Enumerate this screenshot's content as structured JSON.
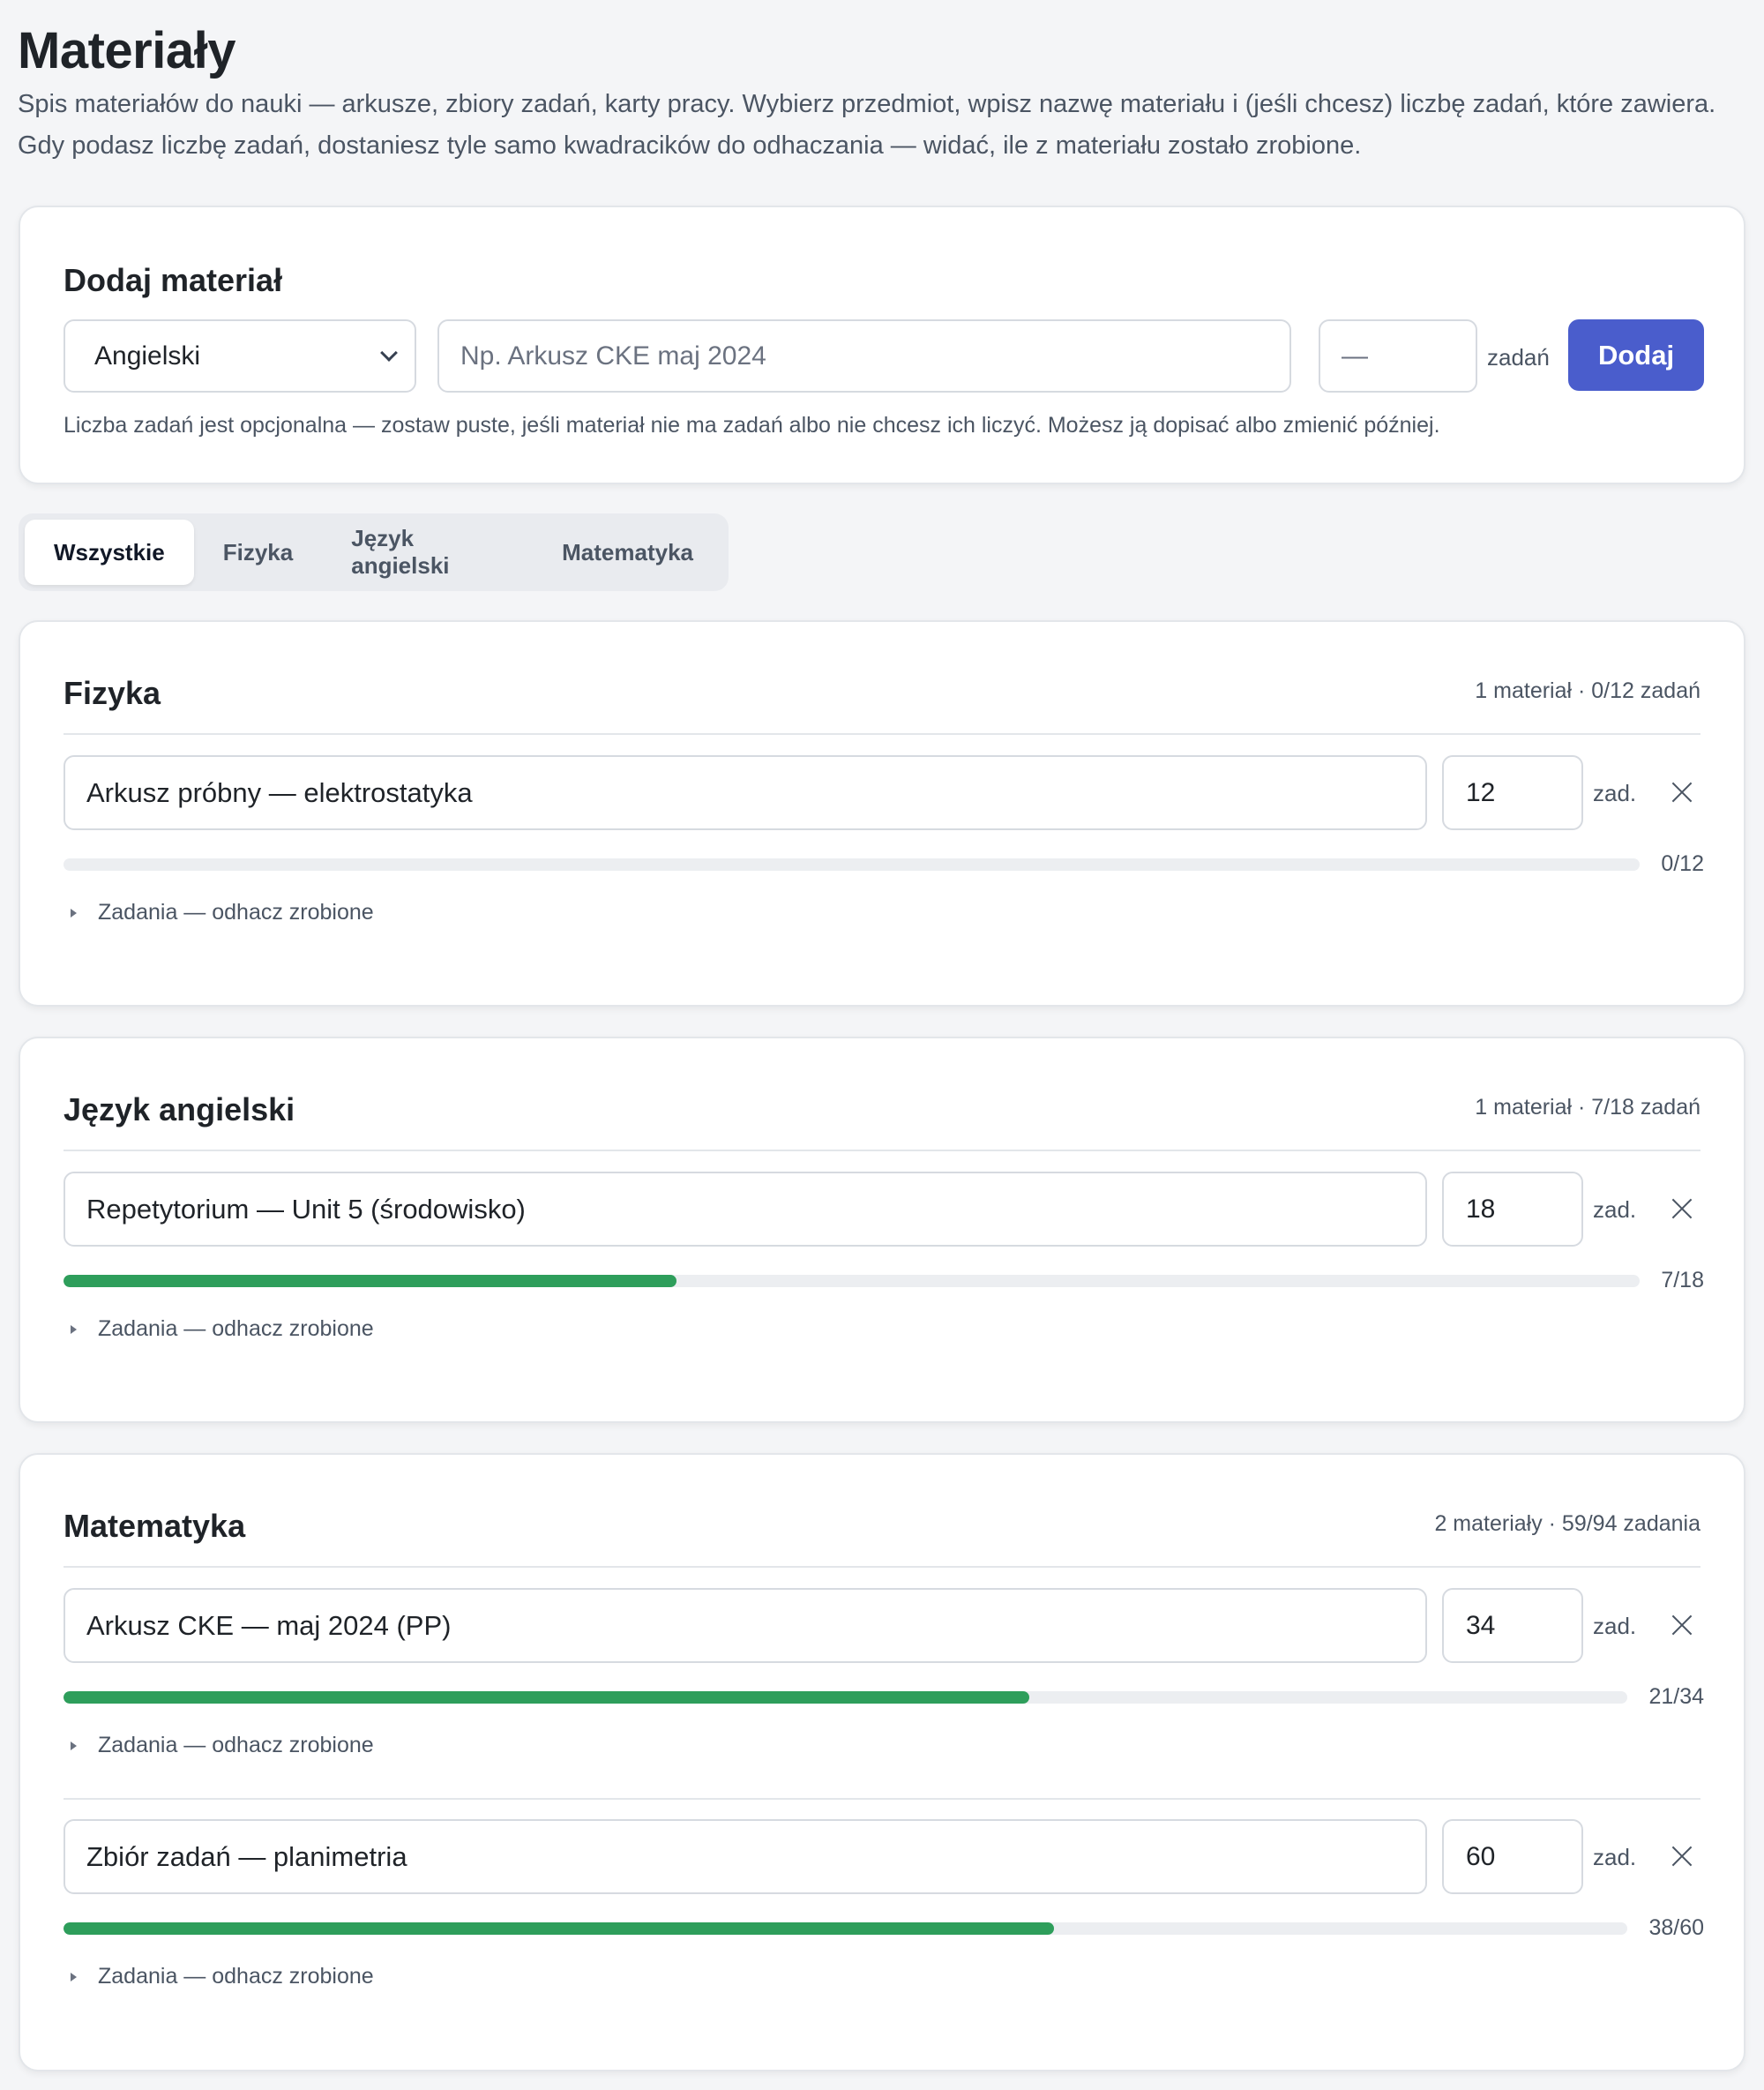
{
  "page": {
    "title": "Materiały",
    "intro_line1": "Spis materiałów do nauki — arkusze, zbiory zadań, karty pracy. Wybierz przedmiot, wpisz nazwę materiału i (jeśli chcesz) liczbę zadań, które zawiera.",
    "intro_line2": "Gdy podasz liczbę zadań, dostaniesz tyle samo kwadracików do odhaczania — widać, ile z materiału zostało zrobione."
  },
  "add_form": {
    "title": "Dodaj materiał",
    "subject_selected": "Angielski",
    "name_placeholder": "Np. Arkusz CKE maj 2024",
    "count_placeholder": "—",
    "count_unit": "zadań",
    "submit_label": "Dodaj",
    "hint": "Liczba zadań jest opcjonalna — zostaw puste, jeśli materiał nie ma zadań albo nie chcesz ich liczyć. Możesz ją dopisać albo zmienić później."
  },
  "tabs": [
    {
      "label": "Wszystkie",
      "active": true
    },
    {
      "label": "Fizyka",
      "active": false
    },
    {
      "label": "Język angielski",
      "active": false
    },
    {
      "label": "Matematyka",
      "active": false
    }
  ],
  "subjects": [
    {
      "title": "Fizyka",
      "summary": "1 materiał · 0/12 zadań",
      "materials": [
        {
          "name": "Arkusz próbny — elektrostatyka",
          "count": "12",
          "unit": "zad.",
          "done": 0,
          "total": 12,
          "progress_label": "0/12",
          "tasks_label": "Zadania — odhacz zrobione"
        }
      ]
    },
    {
      "title": "Język angielski",
      "summary": "1 materiał · 7/18 zadań",
      "materials": [
        {
          "name": "Repetytorium — Unit 5 (środowisko)",
          "count": "18",
          "unit": "zad.",
          "done": 7,
          "total": 18,
          "progress_label": "7/18",
          "tasks_label": "Zadania — odhacz zrobione"
        }
      ]
    },
    {
      "title": "Matematyka",
      "summary": "2 materiały · 59/94 zadania",
      "materials": [
        {
          "name": "Arkusz CKE — maj 2024 (PP)",
          "count": "34",
          "unit": "zad.",
          "done": 21,
          "total": 34,
          "progress_label": "21/34",
          "tasks_label": "Zadania — odhacz zrobione"
        },
        {
          "name": "Zbiór zadań — planimetria",
          "count": "60",
          "unit": "zad.",
          "done": 38,
          "total": 60,
          "progress_label": "38/60",
          "tasks_label": "Zadania — odhacz zrobione"
        }
      ]
    }
  ],
  "colors": {
    "accent": "#4a5dcc",
    "progress": "#2e9e5b",
    "track": "#eceef1"
  }
}
